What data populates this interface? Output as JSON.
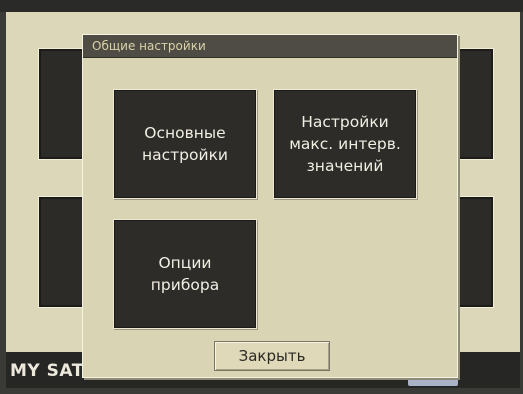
{
  "dialog": {
    "title": "Общие настройки",
    "buttons": [
      {
        "label": "Основные\nнастройки"
      },
      {
        "label": "Настройки\nмакс. интерв.\nзначений"
      },
      {
        "label": "Опции\nприбора"
      }
    ],
    "close_label": "Закрыть"
  },
  "status_bar": {
    "text": "MY SATEC_"
  }
}
